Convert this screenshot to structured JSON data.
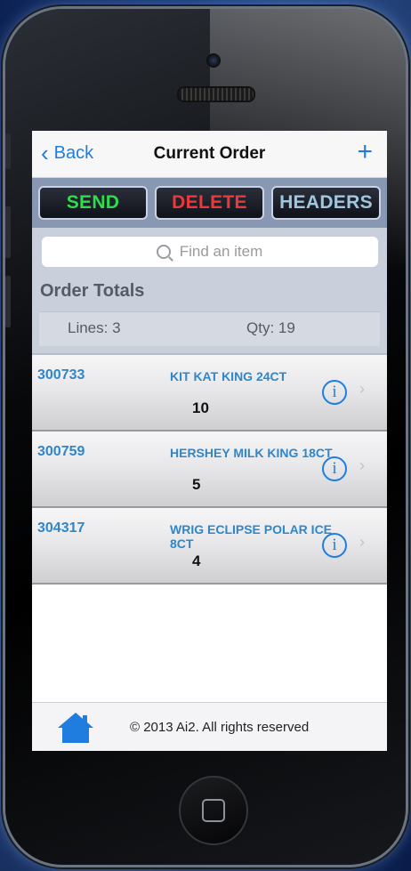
{
  "nav": {
    "back_label": "Back",
    "title": "Current Order",
    "add_label": "+"
  },
  "actions": {
    "send": "SEND",
    "delete": "DELETE",
    "headers": "HEADERS"
  },
  "search": {
    "placeholder": "Find an item"
  },
  "totals": {
    "title": "Order Totals",
    "lines": "Lines: 3",
    "qty": "Qty: 19"
  },
  "items": [
    {
      "sku": "300733",
      "description": "KIT KAT KING 24CT",
      "qty": "10"
    },
    {
      "sku": "300759",
      "description": "HERSHEY MILK KING 18CT",
      "qty": "5"
    },
    {
      "sku": "304317",
      "description": "WRIG ECLIPSE POLAR ICE 8CT",
      "qty": "4"
    }
  ],
  "footer": {
    "copyright": "© 2013 Ai2. All rights reserved"
  },
  "icons": {
    "back": "chevron-left-icon",
    "add": "plus-icon",
    "search": "search-icon",
    "info": "info-icon",
    "row_chevron": "chevron-right-icon",
    "home": "home-icon"
  },
  "colors": {
    "accent": "#1f7de0",
    "send": "#2edc4e",
    "delete": "#e83a3a",
    "headers": "#9fc7de",
    "sku": "#2f86c8"
  }
}
